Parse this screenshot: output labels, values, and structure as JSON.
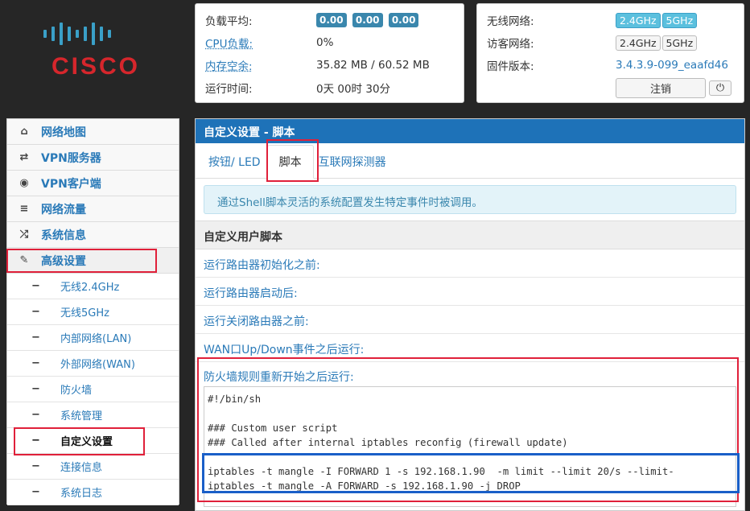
{
  "brand": {
    "logo_text": "CISCO"
  },
  "status": {
    "load_label": "负载平均:",
    "load_values": [
      "0.00",
      "0.00",
      "0.00"
    ],
    "cpu_label": "CPU负载:",
    "cpu_value": "0%",
    "mem_label": "内存空余:",
    "mem_value": "35.82 MB / 60.52 MB",
    "uptime_label": "运行时间:",
    "uptime_value": "0天 00时 30分"
  },
  "wifi": {
    "wireless_label": "无线网络:",
    "guest_label": "访客网络:",
    "firmware_label": "固件版本:",
    "band_24": "2.4GHz",
    "band_5": "5GHz",
    "firmware_value": "3.4.3.9-099_eaafd46",
    "logout_label": "注销",
    "power_icon": "⏻"
  },
  "sidebar": {
    "items": [
      {
        "label": "网络地图",
        "icon": "⌂"
      },
      {
        "label": "VPN服务器",
        "icon": "⇄"
      },
      {
        "label": "VPN客户端",
        "icon": "◉"
      },
      {
        "label": "网络流量",
        "icon": "≡"
      },
      {
        "label": "系统信息",
        "icon": "⤮"
      },
      {
        "label": "高级设置",
        "icon": "✎"
      }
    ],
    "sub_items": [
      {
        "label": "无线2.4GHz"
      },
      {
        "label": "无线5GHz"
      },
      {
        "label": "内部网络(LAN)"
      },
      {
        "label": "外部网络(WAN)"
      },
      {
        "label": "防火墙"
      },
      {
        "label": "系统管理"
      },
      {
        "label": "自定义设置"
      },
      {
        "label": "连接信息"
      },
      {
        "label": "系统日志"
      }
    ],
    "dash": "−"
  },
  "main": {
    "header": "自定义设置 - 脚本",
    "tabs": [
      "按钮/ LED",
      "脚本",
      "互联网探测器"
    ],
    "info": "通过Shell脚本灵活的系统配置发生特定事件时被调用。",
    "section_title": "自定义用户脚本",
    "scripts": [
      "运行路由器初始化之前:",
      "运行路由器启动后:",
      "运行关闭路由器之前:",
      "WAN口Up/Down事件之后运行:"
    ],
    "firewall_title": "防火墙规则重新开始之后运行:",
    "code_lines": [
      "#!/bin/sh",
      "",
      "### Custom user script",
      "### Called after internal iptables reconfig (firewall update)",
      "",
      "iptables -t mangle -I FORWARD 1 -s 192.168.1.90  -m limit --limit 20/s --limit-",
      "iptables -t mangle -A FORWARD -s 192.168.1.90 -j DROP"
    ]
  }
}
